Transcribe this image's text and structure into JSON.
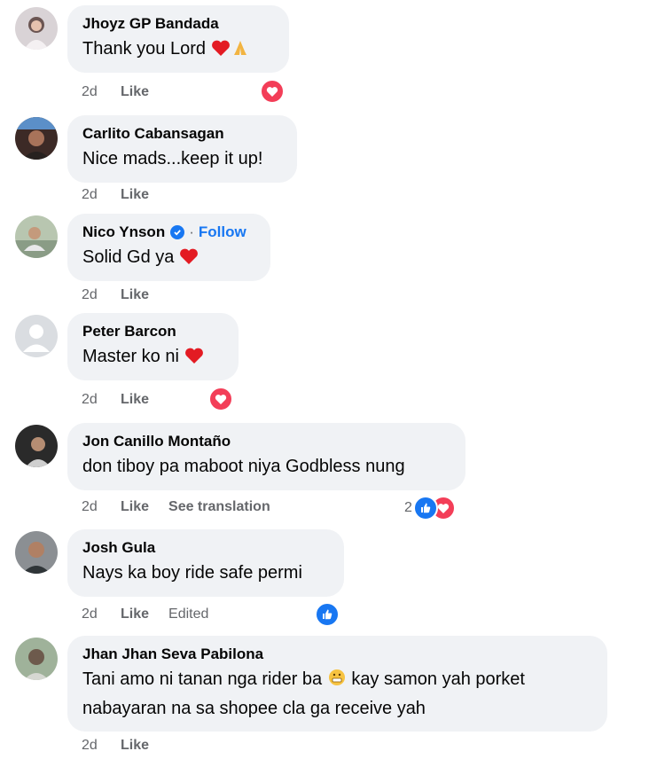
{
  "comments": [
    {
      "name": "Jhoyz GP Bandada",
      "text": "Thank you Lord",
      "time": "2d",
      "like": "Like"
    },
    {
      "name": "Carlito Cabansagan",
      "text": "Nice mads...keep it up!",
      "time": "2d",
      "like": "Like"
    },
    {
      "name": "Nico Ynson",
      "follow": "Follow",
      "text": "Solid Gd ya",
      "time": "2d",
      "like": "Like"
    },
    {
      "name": "Peter Barcon",
      "text": "Master ko ni",
      "time": "2d",
      "like": "Like"
    },
    {
      "name": "Jon Canillo Montaño",
      "text": "don tiboy pa maboot niya Godbless nung",
      "time": "2d",
      "like": "Like",
      "see_translation": "See translation",
      "reaction_count": "2"
    },
    {
      "name": "Josh Gula",
      "text": "Nays ka boy ride safe permi",
      "time": "2d",
      "like": "Like",
      "edited": "Edited"
    },
    {
      "name": "Jhan Jhan Seva Pabilona",
      "text_line1": "Tani amo ni tanan nga rider ba",
      "text_line1b": "kay samon yah porket",
      "text_line2": "nabayaran na sa shopee cla ga receive yah",
      "time": "2d",
      "like": "Like"
    }
  ],
  "colors": {
    "love": "#f33e58",
    "like": "#1877f2",
    "bubble": "#f0f2f5",
    "meta": "#65676b"
  },
  "icons": [
    "heart-emoji",
    "praying-hands-emoji",
    "verified-badge-icon",
    "love-reaction-icon",
    "like-reaction-icon",
    "grimace-emoji"
  ]
}
